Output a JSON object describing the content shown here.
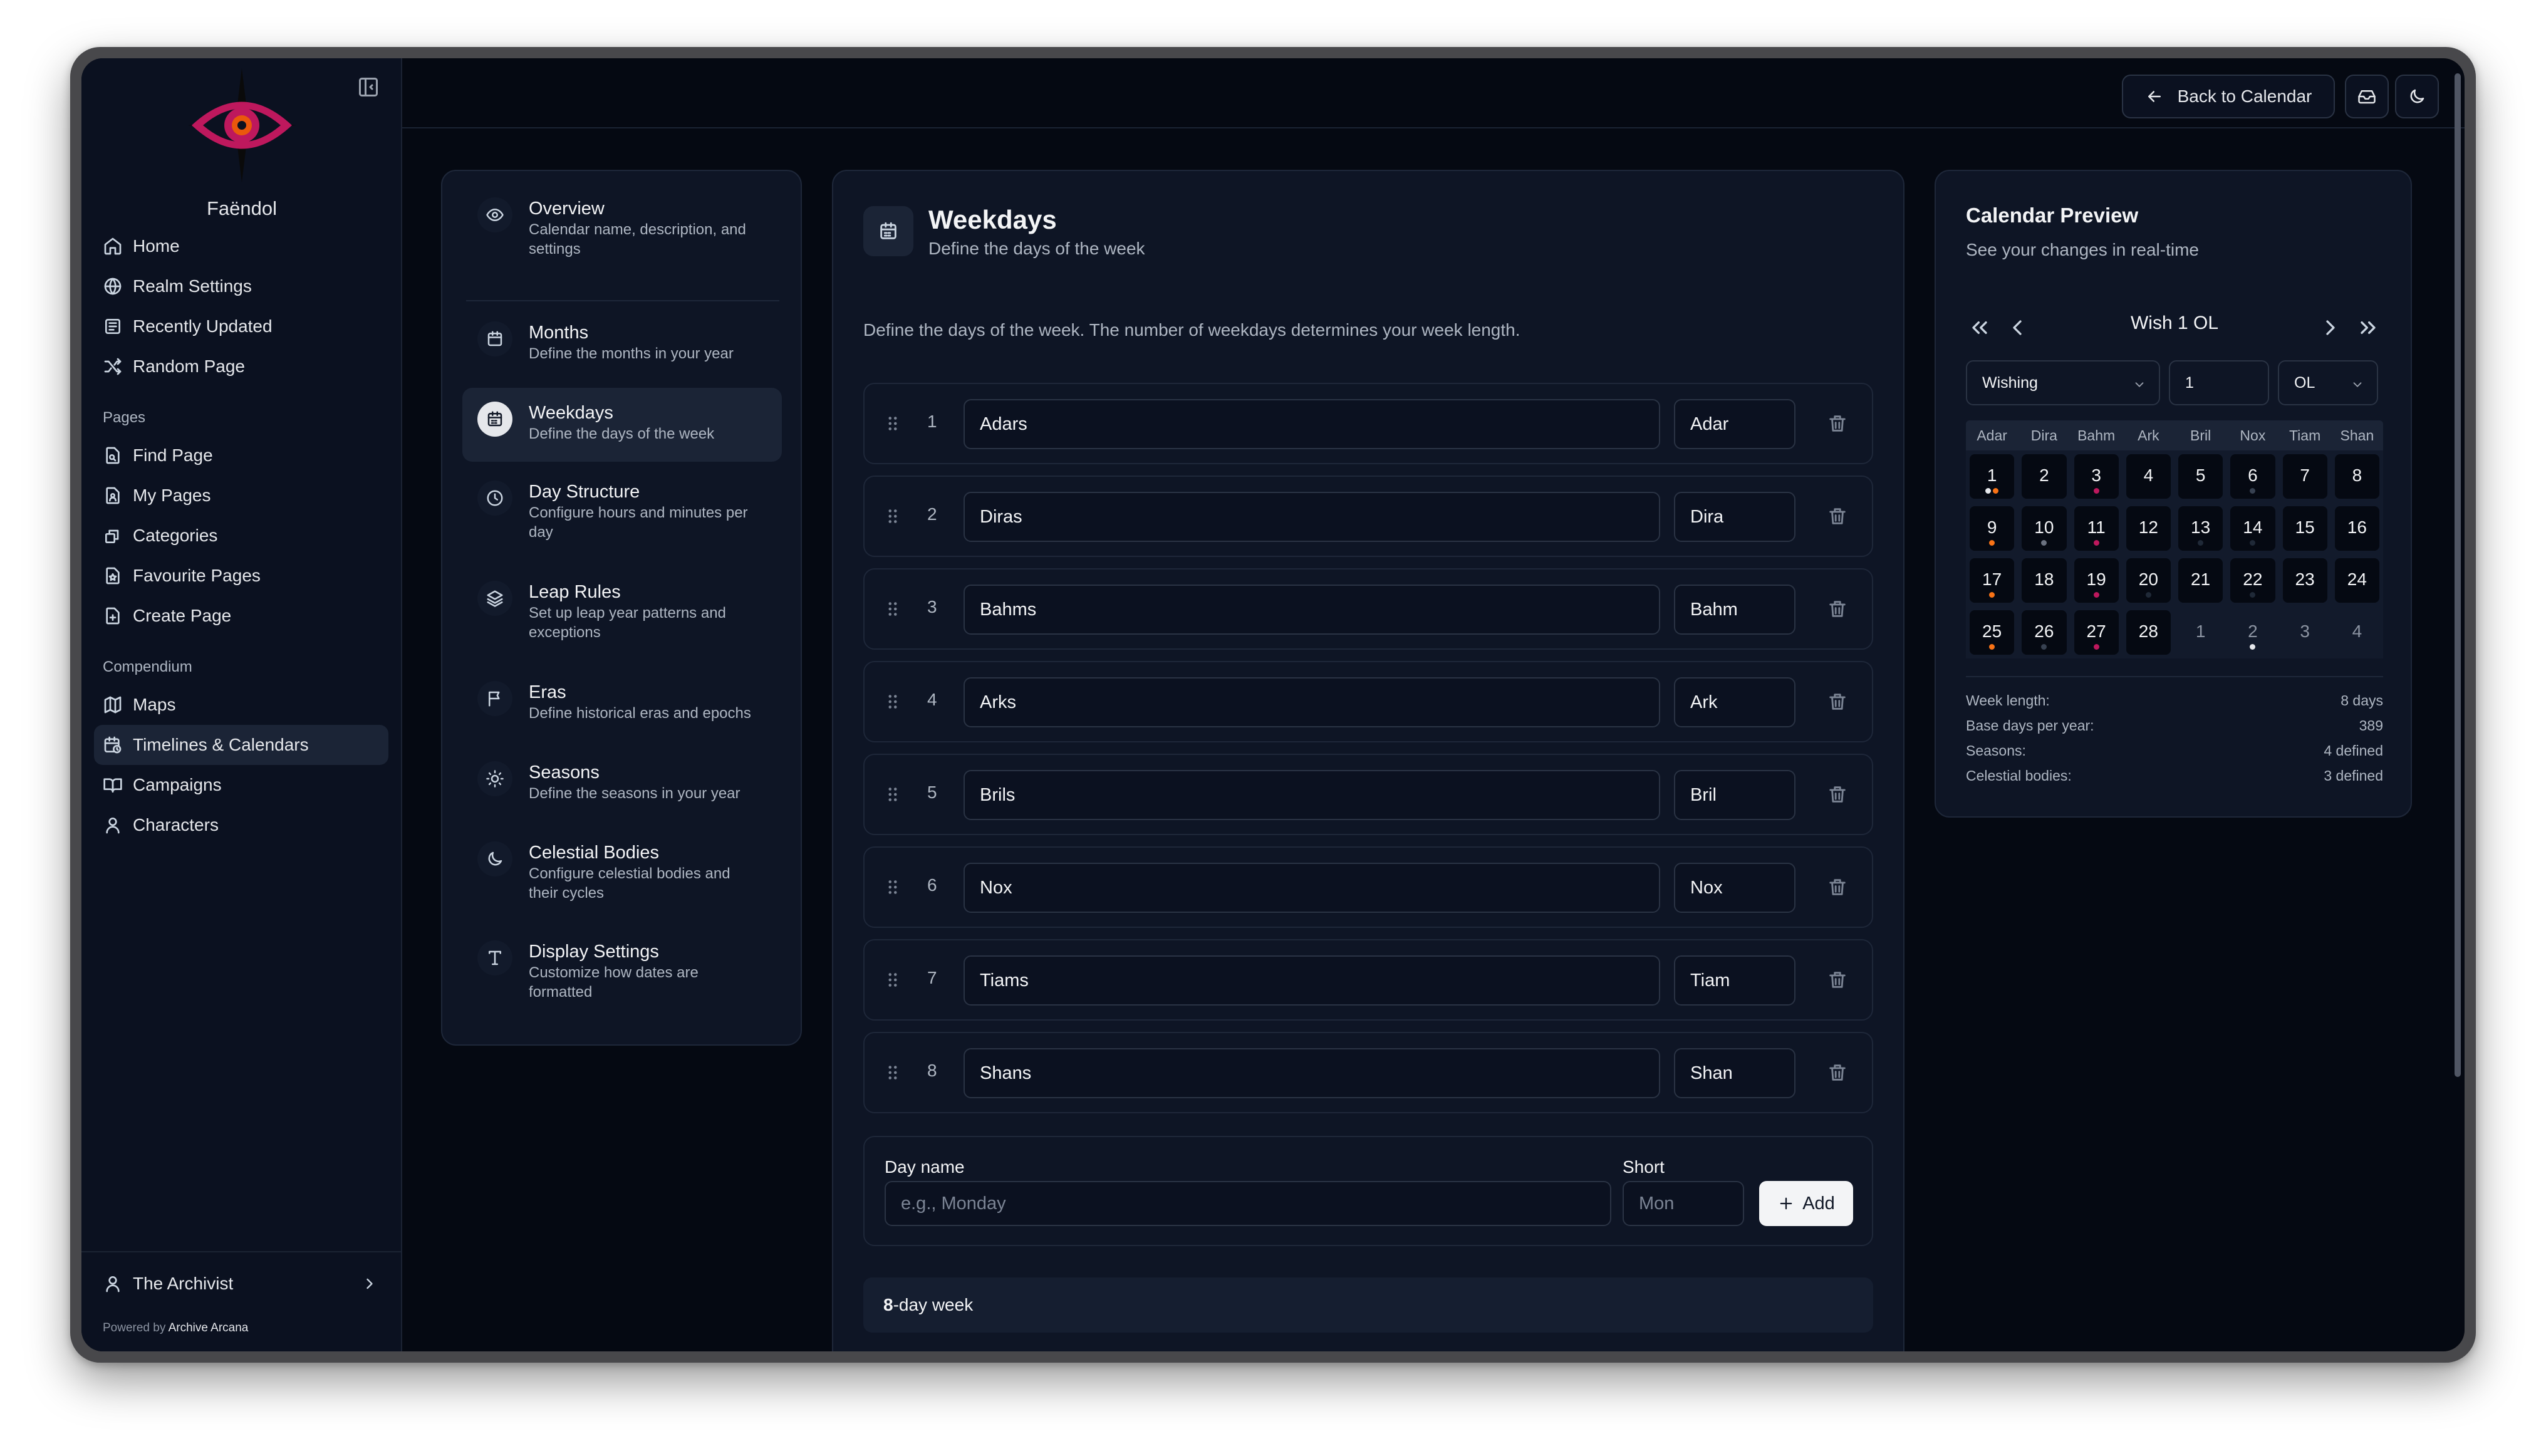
{
  "app": {
    "name": "Faëndol"
  },
  "sidebar": {
    "main_items": [
      {
        "label": "Home",
        "icon": "home-icon"
      },
      {
        "label": "Realm Settings",
        "icon": "globe-icon"
      },
      {
        "label": "Recently Updated",
        "icon": "newspaper-icon"
      },
      {
        "label": "Random Page",
        "icon": "shuffle-icon"
      }
    ],
    "pages_heading": "Pages",
    "pages_items": [
      {
        "label": "Find Page",
        "icon": "file-search-icon"
      },
      {
        "label": "My Pages",
        "icon": "file-user-icon"
      },
      {
        "label": "Categories",
        "icon": "categories-icon"
      },
      {
        "label": "Favourite Pages",
        "icon": "file-star-icon"
      },
      {
        "label": "Create Page",
        "icon": "file-plus-icon"
      }
    ],
    "compendium_heading": "Compendium",
    "compendium_items": [
      {
        "label": "Maps",
        "icon": "map-icon"
      },
      {
        "label": "Timelines & Calendars",
        "icon": "calendar-clock-icon",
        "active": true
      },
      {
        "label": "Campaigns",
        "icon": "book-open-icon"
      },
      {
        "label": "Characters",
        "icon": "user-icon"
      }
    ],
    "user": {
      "name": "The Archivist"
    },
    "powered_by_prefix": "Powered by",
    "powered_by_brand": "Archive Arcana"
  },
  "topbar": {
    "back_label": "Back to Calendar",
    "icons": [
      "inbox-icon",
      "moon-icon"
    ]
  },
  "sections": [
    {
      "title": "Overview",
      "desc": "Calendar name, description, and settings",
      "icon": "eye-icon"
    },
    {
      "title": "Months",
      "desc": "Define the months in your year",
      "icon": "calendar-icon"
    },
    {
      "title": "Weekdays",
      "desc": "Define the days of the week",
      "icon": "calendar-days-icon",
      "active": true
    },
    {
      "title": "Day Structure",
      "desc": "Configure hours and minutes per day",
      "icon": "clock-icon"
    },
    {
      "title": "Leap Rules",
      "desc": "Set up leap year patterns and exceptions",
      "icon": "layers-icon"
    },
    {
      "title": "Eras",
      "desc": "Define historical eras and epochs",
      "icon": "flag-icon"
    },
    {
      "title": "Seasons",
      "desc": "Define the seasons in your year",
      "icon": "sun-icon"
    },
    {
      "title": "Celestial Bodies",
      "desc": "Configure celestial bodies and their cycles",
      "icon": "moon-icon"
    },
    {
      "title": "Display Settings",
      "desc": "Customize how dates are formatted",
      "icon": "type-icon"
    }
  ],
  "main": {
    "title": "Weekdays",
    "subtitle": "Define the days of the week",
    "description": "Define the days of the week. The number of weekdays determines your week length.",
    "weekdays": [
      {
        "num": "1",
        "name": "Adars",
        "short": "Adar"
      },
      {
        "num": "2",
        "name": "Diras",
        "short": "Dira"
      },
      {
        "num": "3",
        "name": "Bahms",
        "short": "Bahm"
      },
      {
        "num": "4",
        "name": "Arks",
        "short": "Ark"
      },
      {
        "num": "5",
        "name": "Brils",
        "short": "Bril"
      },
      {
        "num": "6",
        "name": "Nox",
        "short": "Nox"
      },
      {
        "num": "7",
        "name": "Tiams",
        "short": "Tiam"
      },
      {
        "num": "8",
        "name": "Shans",
        "short": "Shan"
      }
    ],
    "add_form": {
      "name_label": "Day name",
      "name_placeholder": "e.g., Monday",
      "short_label": "Short",
      "short_placeholder": "Mon",
      "add_label": "Add"
    },
    "summary_count": "8",
    "summary_suffix": "-day week"
  },
  "preview": {
    "title": "Calendar Preview",
    "subtitle": "See your changes in real-time",
    "current_label": "Wish 1 OL",
    "month_select": "Wishing",
    "day_input": "1",
    "era_select": "OL",
    "weekday_headers": [
      "Adar",
      "Dira",
      "Bahm",
      "Ark",
      "Bril",
      "Nox",
      "Tiam",
      "Shan"
    ],
    "weeks": [
      [
        {
          "d": "1",
          "dots": [
            "#e5e7eb",
            "#f97316"
          ]
        },
        {
          "d": "2"
        },
        {
          "d": "3",
          "dots": [
            "#be185d"
          ]
        },
        {
          "d": "4"
        },
        {
          "d": "5"
        },
        {
          "d": "6",
          "dots": [
            "#374151"
          ]
        },
        {
          "d": "7"
        },
        {
          "d": "8"
        }
      ],
      [
        {
          "d": "9",
          "dots": [
            "#f97316"
          ]
        },
        {
          "d": "10",
          "dots": [
            "#6b7280"
          ]
        },
        {
          "d": "11",
          "dots": [
            "#be185d"
          ]
        },
        {
          "d": "12"
        },
        {
          "d": "13",
          "dots": [
            "#1f2937"
          ]
        },
        {
          "d": "14",
          "dots": [
            "#1f2937"
          ]
        },
        {
          "d": "15"
        },
        {
          "d": "16"
        }
      ],
      [
        {
          "d": "17",
          "dots": [
            "#f97316"
          ]
        },
        {
          "d": "18"
        },
        {
          "d": "19",
          "dots": [
            "#be185d"
          ]
        },
        {
          "d": "20",
          "dots": [
            "#1f2937"
          ]
        },
        {
          "d": "21"
        },
        {
          "d": "22",
          "dots": [
            "#1f2937"
          ]
        },
        {
          "d": "23"
        },
        {
          "d": "24"
        }
      ],
      [
        {
          "d": "25",
          "dots": [
            "#f97316"
          ]
        },
        {
          "d": "26",
          "dots": [
            "#374151"
          ]
        },
        {
          "d": "27",
          "dots": [
            "#be185d"
          ]
        },
        {
          "d": "28"
        },
        {
          "d": "1",
          "out": true
        },
        {
          "d": "2",
          "out": true,
          "dots": [
            "#e5e7eb"
          ]
        },
        {
          "d": "3",
          "out": true
        },
        {
          "d": "4",
          "out": true
        }
      ]
    ],
    "stats": [
      {
        "label": "Week length:",
        "value": "8 days"
      },
      {
        "label": "Base days per year:",
        "value": "389"
      },
      {
        "label": "Seasons:",
        "value": "4 defined"
      },
      {
        "label": "Celestial bodies:",
        "value": "3 defined"
      }
    ]
  },
  "colors": {
    "accent_logo": "#be185d",
    "logo_iris": "#ea580c",
    "background": "#050912",
    "panel": "#0e1525"
  }
}
